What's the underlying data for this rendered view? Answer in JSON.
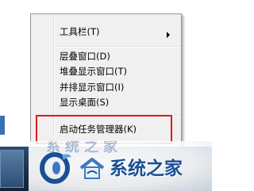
{
  "context_menu": {
    "items": [
      {
        "label": "工具栏(T)",
        "has_submenu": true
      },
      {
        "label": "层叠窗口(D)"
      },
      {
        "label": "堆叠显示窗口(T)"
      },
      {
        "label": "并排显示窗口(I)"
      },
      {
        "label": "显示桌面(S)"
      },
      {
        "label": "启动任务管理器(K)"
      }
    ]
  },
  "watermark": {
    "text": "系统之家",
    "faint_text": "系统之家",
    "brand_color": "#1a4f94"
  },
  "colors": {
    "menu_bg": "#f0f0f0",
    "highlight_border": "#e0191e",
    "taskbar": "#1b2f48"
  },
  "icons": {
    "submenu_arrow": "chevron-right-icon",
    "logo": "system-home-logo-icon"
  }
}
